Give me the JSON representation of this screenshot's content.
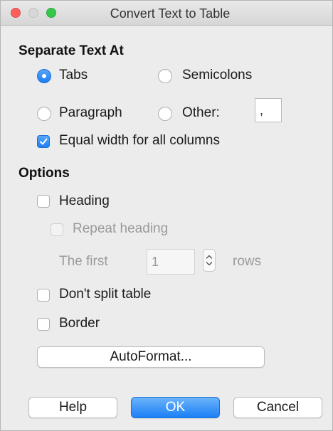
{
  "window": {
    "title": "Convert Text to Table"
  },
  "separate": {
    "heading": "Separate Text At",
    "tabs_label": "Tabs",
    "semicolons_label": "Semicolons",
    "paragraph_label": "Paragraph",
    "other_label": "Other:",
    "other_value": ",",
    "equal_width_label": "Equal width for all columns",
    "selected": "tabs",
    "equal_width_checked": true
  },
  "options": {
    "heading": "Options",
    "heading_label": "Heading",
    "repeat_heading_label": "Repeat heading",
    "the_first_label": "The first",
    "rows_value": "1",
    "rows_label": "rows",
    "dont_split_label": "Don't split table",
    "border_label": "Border",
    "autoformat_label": "AutoFormat..."
  },
  "buttons": {
    "help": "Help",
    "ok": "OK",
    "cancel": "Cancel"
  },
  "icons": {
    "check": "checkmark-icon",
    "stepper": "stepper-updown-icon"
  },
  "colors": {
    "accent": "#1b7ef5",
    "close": "#fc605c",
    "minimize": "#d7d7d7",
    "zoom": "#34c84a"
  }
}
